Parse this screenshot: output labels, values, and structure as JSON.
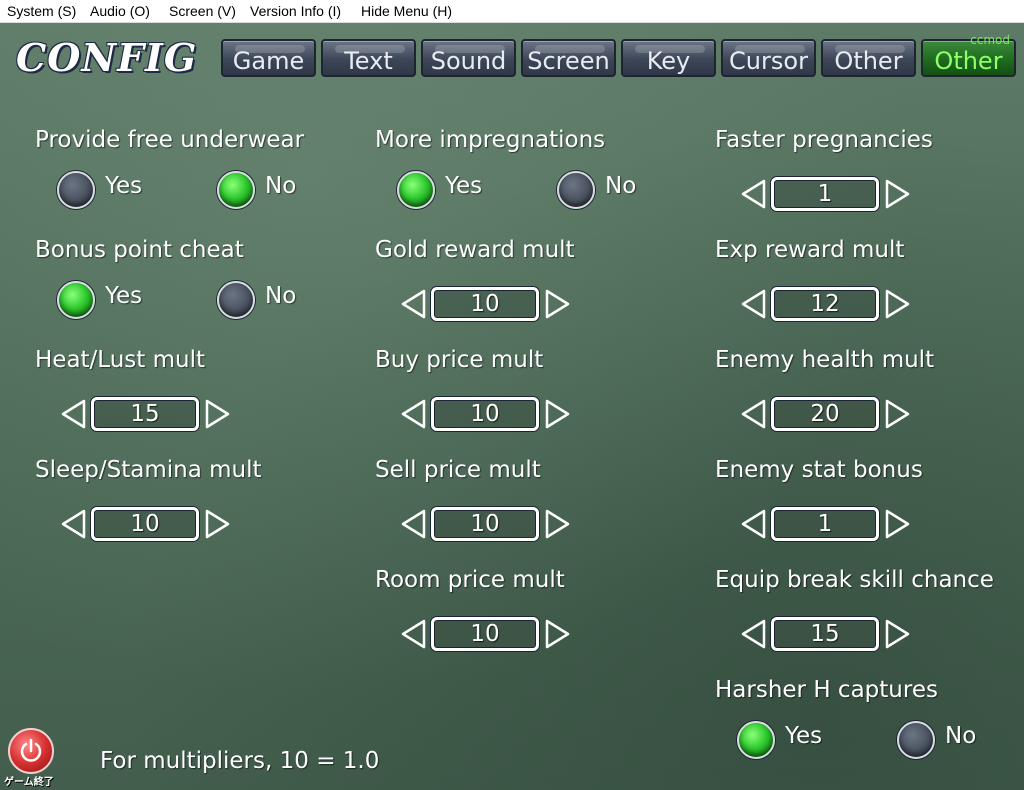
{
  "menubar": {
    "items": [
      "System (S)",
      "Audio (O)",
      "Screen (V)",
      "Version Info (I)",
      "Hide Menu (H)"
    ]
  },
  "logo": "CONFIG",
  "tabs": [
    {
      "label": "Game"
    },
    {
      "label": "Text"
    },
    {
      "label": "Sound"
    },
    {
      "label": "Screen"
    },
    {
      "label": "Key"
    },
    {
      "label": "Cursor"
    },
    {
      "label": "Other"
    },
    {
      "label": "Other",
      "badge": "ccmod",
      "active": true
    }
  ],
  "settings": {
    "free_underwear": {
      "label": "Provide free underwear",
      "yes": "Yes",
      "no": "No",
      "selected": "No"
    },
    "bonus_point": {
      "label": "Bonus point cheat",
      "yes": "Yes",
      "no": "No",
      "selected": "Yes"
    },
    "heat_lust": {
      "label": "Heat/Lust mult",
      "value": "15"
    },
    "sleep_stamina": {
      "label": "Sleep/Stamina mult",
      "value": "10"
    },
    "more_impregnations": {
      "label": "More impregnations",
      "yes": "Yes",
      "no": "No",
      "selected": "Yes"
    },
    "gold_reward": {
      "label": "Gold reward mult",
      "value": "10"
    },
    "buy_price": {
      "label": "Buy price mult",
      "value": "10"
    },
    "sell_price": {
      "label": "Sell price mult",
      "value": "10"
    },
    "room_price": {
      "label": "Room price mult",
      "value": "10"
    },
    "faster_pregnancies": {
      "label": "Faster pregnancies",
      "value": "1"
    },
    "exp_reward": {
      "label": "Exp reward mult",
      "value": "12"
    },
    "enemy_health": {
      "label": "Enemy health mult",
      "value": "20"
    },
    "enemy_stat": {
      "label": "Enemy stat bonus",
      "value": "1"
    },
    "equip_break": {
      "label": "Equip break skill chance",
      "value": "15"
    },
    "harsher_h": {
      "label": "Harsher H captures",
      "yes": "Yes",
      "no": "No",
      "selected": "Yes"
    }
  },
  "footer_note": "For multipliers, 10 = 1.0",
  "exit": {
    "label": "ゲーム終了"
  },
  "colors": {
    "accent_on": "#2fcb2f",
    "panel": "#4f6b58",
    "tab": "#3c4657",
    "tab_active": "#1f6b1f"
  }
}
